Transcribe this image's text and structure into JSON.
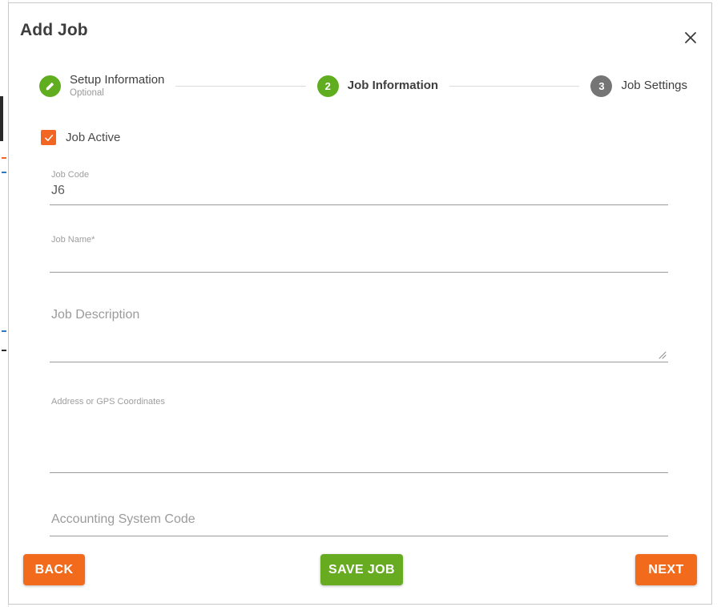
{
  "modal": {
    "title": "Add Job",
    "close_icon": "close-icon"
  },
  "stepper": {
    "steps": [
      {
        "number": "1",
        "icon": "pencil-icon",
        "label": "Setup Information",
        "sublabel": "Optional",
        "state": "complete",
        "color": "#60ae1f"
      },
      {
        "number": "2",
        "label": "Job Information",
        "sublabel": "",
        "state": "active",
        "color": "#60ae1f"
      },
      {
        "number": "3",
        "label": "Job Settings",
        "sublabel": "",
        "state": "upcoming",
        "color": "#757575"
      }
    ]
  },
  "form": {
    "job_active": {
      "label": "Job Active",
      "checked": true,
      "check_icon": "check-icon",
      "color": "#f26522"
    },
    "fields": [
      {
        "name": "job-code",
        "label": "Job Code",
        "value": "J6",
        "placeholder": "Job Code"
      },
      {
        "name": "job-name",
        "label": "Job Name*",
        "value": "",
        "placeholder": "Job Name*"
      },
      {
        "name": "job-description",
        "label": "Job Description",
        "value": "",
        "placeholder": "Job Description",
        "resizable": true
      },
      {
        "name": "address-or-gps-coordinates",
        "label": "Address or GPS Coordinates",
        "value": "",
        "placeholder": "Address or GPS Coordinates"
      },
      {
        "name": "accounting-system-code",
        "label": "Accounting System Code",
        "value": "",
        "placeholder": "Accounting System Code"
      }
    ]
  },
  "footer": {
    "back_label": "BACK",
    "save_label": "SAVE JOB",
    "next_label": "NEXT",
    "back_color": "#f26a1b",
    "save_color": "#66ab20",
    "next_color": "#f26a1b"
  }
}
